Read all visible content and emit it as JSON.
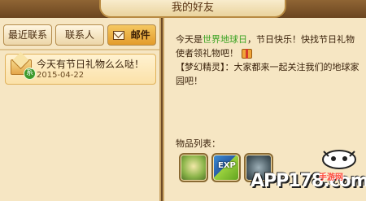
{
  "window": {
    "title": "我的好友"
  },
  "tabs": [
    {
      "label": "最近联系",
      "active": false
    },
    {
      "label": "联系人",
      "active": false
    },
    {
      "label": "邮件",
      "icon": "mail-icon",
      "active": true
    }
  ],
  "mail_list": [
    {
      "subject": "今天有节日礼物么么哒！",
      "date": "2015-04-22",
      "badge": "系",
      "icon": "envelope-icon"
    }
  ],
  "message": {
    "line1_prefix": "今天是",
    "line1_highlight": "世界地球日",
    "line1_suffix": "，节日快乐！快找节日礼物",
    "line2": "使者领礼物吧！",
    "line3": "【梦幻精灵】：大家都来一起关注我们的地球家园吧！"
  },
  "items": {
    "label": "物品列表：",
    "slots": [
      {
        "name": "scroll-item",
        "text": ""
      },
      {
        "name": "exp-card-item",
        "text": "EXP"
      },
      {
        "name": "stone-item",
        "text": ""
      }
    ]
  },
  "watermark": {
    "text": "APP178.com",
    "sub": "手游网"
  },
  "colors": {
    "accent": "#e39b2b",
    "highlight": "#3aa322",
    "panel": "#f6e6c3",
    "frame": "#6e4a26"
  }
}
